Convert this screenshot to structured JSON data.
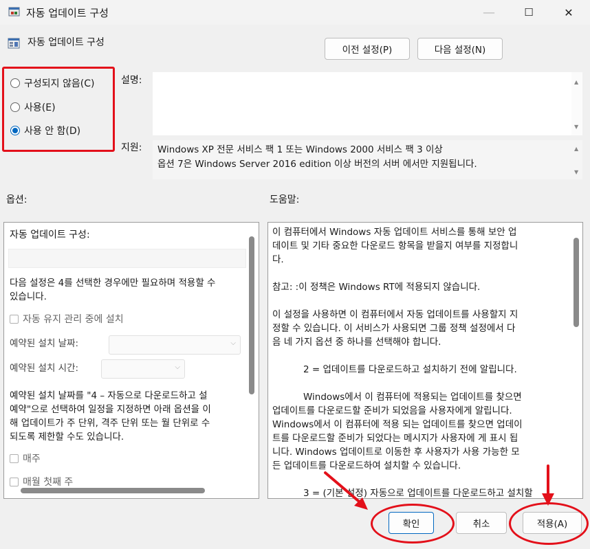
{
  "window": {
    "title": "자동 업데이트 구성",
    "minimize": "—",
    "maximize": "☐",
    "close": "✕"
  },
  "header": {
    "policy_name": "자동 업데이트 구성",
    "prev_button": "이전 설정(P)",
    "next_button": "다음 설정(N)"
  },
  "state_options": [
    {
      "label": "구성되지 않음(C)",
      "selected": false
    },
    {
      "label": "사용(E)",
      "selected": false
    },
    {
      "label": "사용 안 함(D)",
      "selected": true
    }
  ],
  "comment_label": "설명:",
  "comment_value": "",
  "supported_label": "지원:",
  "supported_lines": [
    "Windows XP 전문 서비스 팩 1 또는 Windows 2000 서비스 팩 3 이상",
    "옵션 7은 Windows Server 2016 edition 이상 버전의 서버 에서만 지원됩니다."
  ],
  "options_label": "옵션:",
  "help_label": "도움말:",
  "options_panel": {
    "configure_label": "자동 업데이트 구성:",
    "configure_value": "",
    "note_lines": [
      "다음 설정은 4를 선택한 경우에만 필요하며 적용할 수",
      "있습니다."
    ],
    "install_maintenance": "자동 유지 관리 중에 설치",
    "scheduled_day_label": "예약된 설치 날짜:",
    "scheduled_day_value": "",
    "scheduled_time_label": "예약된 설치 시간:",
    "scheduled_time_value": "",
    "desc_lines": [
      "예약된 설치 날짜를 \"4 – 자동으로 다운로드하고 설",
      "예약\"으로 선택하여 일정을 지정하면 아래 옵션을 이",
      "해 업데이트가 주 단위, 격주 단위 또는 월 단위로 수",
      "되도록 제한할 수도 있습니다."
    ],
    "weekly": "매주",
    "first_week": "매월 첫째 주"
  },
  "help_panel": {
    "para1": [
      "이 컴퓨터에서 Windows 자동 업데이트 서비스를 통해 보안 업",
      "데이트 및 기타 중요한 다운로드 항목을 받을지 여부를 지정합니",
      "다."
    ],
    "para2": [
      "참고: :이 정책은 Windows RT에 적용되지 않습니다."
    ],
    "para3": [
      "이 설정을 사용하면 이 컴퓨터에서 자동 업데이트를 사용할지 지",
      "정할 수 있습니다. 이 서비스가 사용되면 그룹 정책 설정에서 다",
      "음 네 가지 옵션 중 하나를 선택해야 합니다."
    ],
    "para4": [
      "2 = 업데이트를 다운로드하고 설치하기 전에 알립니다."
    ],
    "para5": [
      "Windows에서 이 컴퓨터에 적용되는 업데이트를 찾으면",
      "업데이트를 다운로드할 준비가 되었음을 사용자에게 알립니다.",
      "Windows에서 이 컴퓨터에 적용 되는 업데이트를 찾으면 업데이",
      "트를 다운로드할 준비가 되었다는 메시지가 사용자에 게 표시 됩",
      "니다. Windows 업데이트로 이동한 후 사용자가 사용 가능한 모",
      "든 업데이트를 다운로드하여 설치할 수 있습니다."
    ],
    "para6": [
      "3 = (기본 설정) 자동으로 업데이트를 다운로드하고 설치할"
    ]
  },
  "footer": {
    "ok": "확인",
    "cancel": "취소",
    "apply": "적용(A)"
  },
  "colors": {
    "annotation_red": "#e3101a",
    "radio_accent": "#0067c0"
  }
}
